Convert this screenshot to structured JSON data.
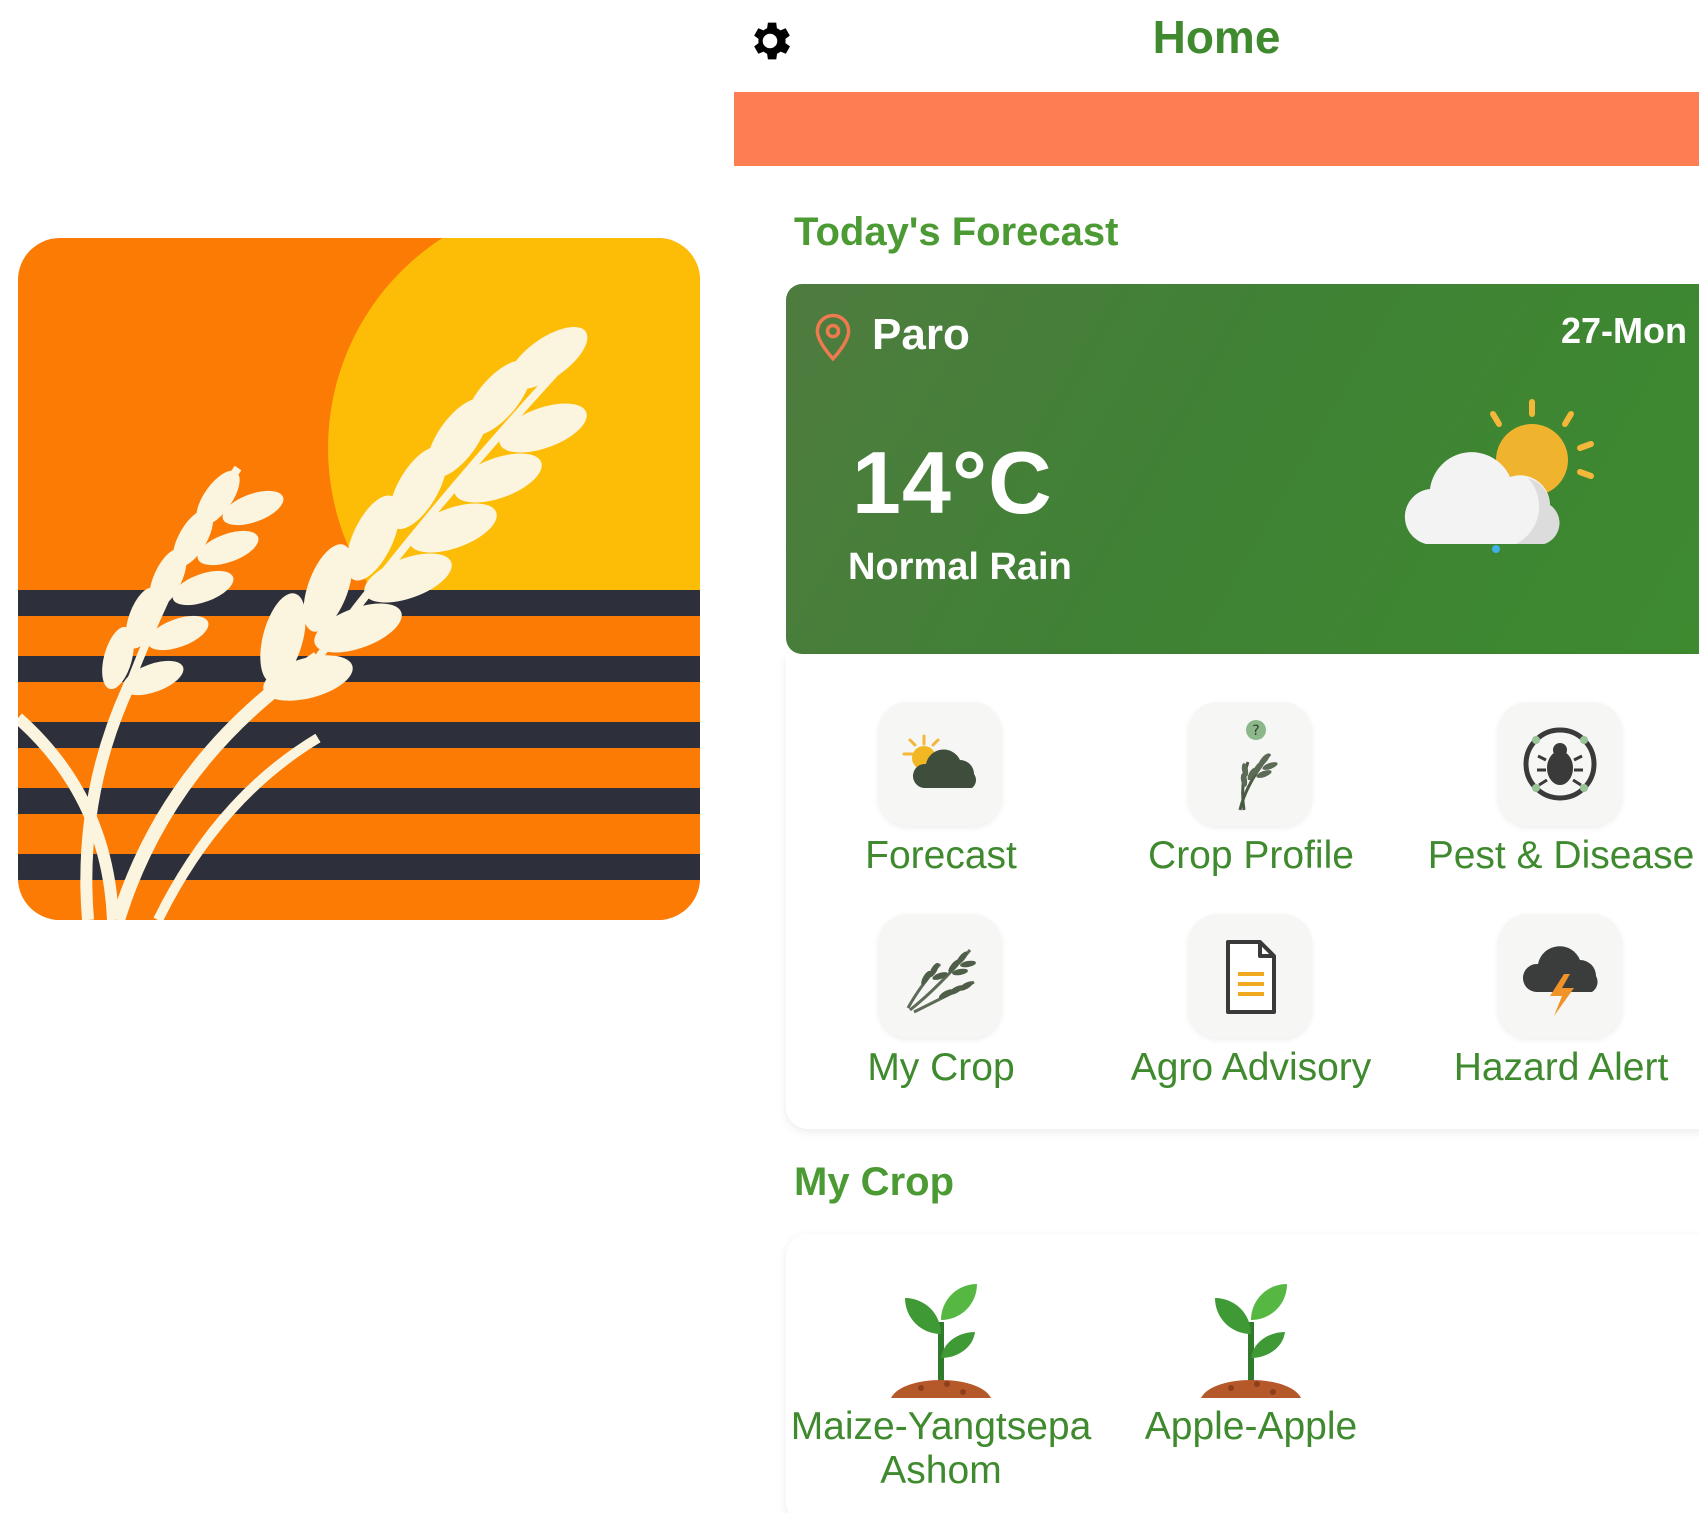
{
  "header": {
    "title": "Home",
    "settings_icon": "gear-icon"
  },
  "colors": {
    "brand_green": "#3f8a2e",
    "banner": "#fd7e52",
    "weather_card": "#3f8135"
  },
  "forecast_section": {
    "title": "Today's Forecast"
  },
  "weather": {
    "location": "Paro",
    "date": "27-Mon",
    "temperature": "14°C",
    "condition": "Normal Rain",
    "icon": "partly-cloudy-icon"
  },
  "quick_actions": [
    {
      "label": "Forecast",
      "icon": "weather-forecast-icon"
    },
    {
      "label": "Crop Profile",
      "icon": "crop-profile-icon"
    },
    {
      "label": "Pest & Disease",
      "icon": "pest-bug-icon"
    },
    {
      "label": "My Crop",
      "icon": "wheat-icon"
    },
    {
      "label": "Agro Advisory",
      "icon": "document-icon"
    },
    {
      "label": "Hazard Alert",
      "icon": "storm-cloud-icon"
    }
  ],
  "my_crop_section": {
    "title": "My Crop"
  },
  "my_crops": [
    {
      "line1": "Maize-Yangtsepa",
      "line2": "Ashom",
      "icon": "seedling-icon"
    },
    {
      "line1": "Apple-Apple",
      "line2": "",
      "icon": "seedling-icon"
    }
  ]
}
